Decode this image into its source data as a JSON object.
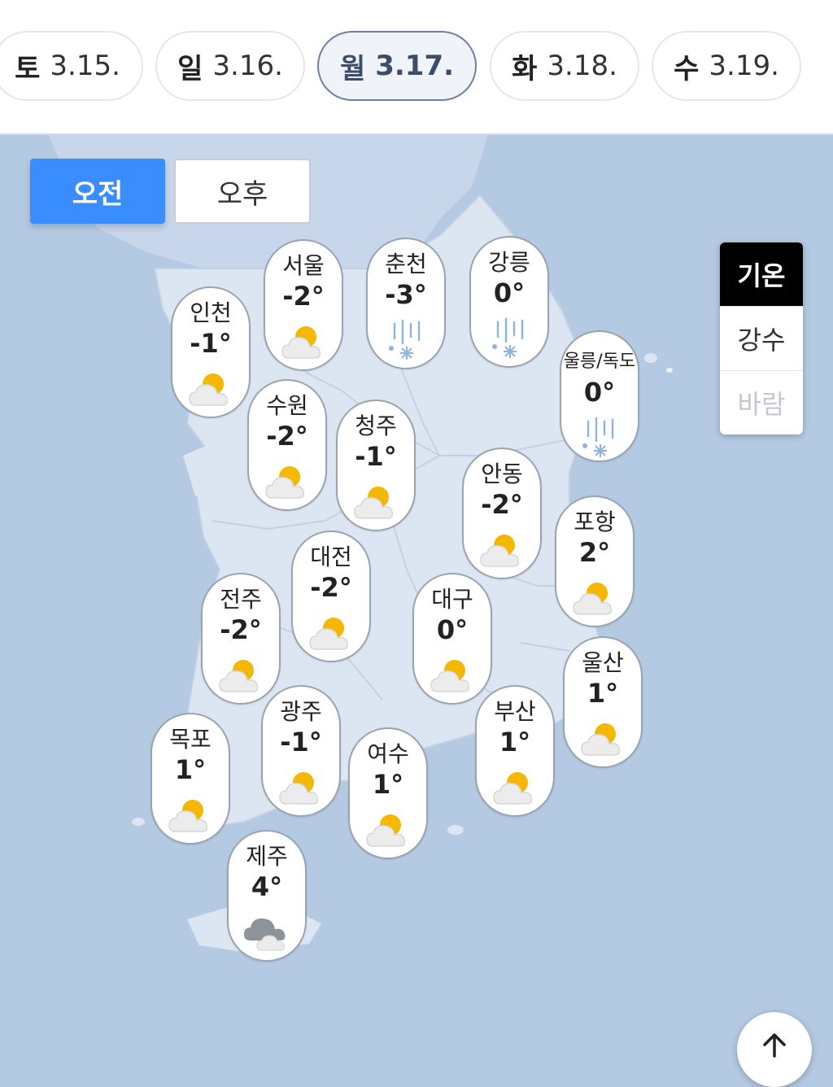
{
  "date_tabs": [
    {
      "dow": "토",
      "date": "3.15.",
      "selected": false
    },
    {
      "dow": "일",
      "date": "3.16.",
      "selected": false
    },
    {
      "dow": "월",
      "date": "3.17.",
      "selected": true
    },
    {
      "dow": "화",
      "date": "3.18.",
      "selected": false
    },
    {
      "dow": "수",
      "date": "3.19.",
      "selected": false
    }
  ],
  "period_toggle": {
    "am": "오전",
    "pm": "오후",
    "selected": "오전"
  },
  "layer_selector": {
    "temperature": "기온",
    "precipitation": "강수",
    "wind": "바람",
    "selected": "기온"
  },
  "cities": [
    {
      "name": "서울",
      "temp": "-2°",
      "icon": "partly-cloudy-icon"
    },
    {
      "name": "춘천",
      "temp": "-3°",
      "icon": "snow-icon"
    },
    {
      "name": "강릉",
      "temp": "0°",
      "icon": "snow-icon"
    },
    {
      "name": "인천",
      "temp": "-1°",
      "icon": "partly-cloudy-icon"
    },
    {
      "name": "울릉/독도",
      "temp": "0°",
      "icon": "snow-icon"
    },
    {
      "name": "수원",
      "temp": "-2°",
      "icon": "partly-cloudy-icon"
    },
    {
      "name": "청주",
      "temp": "-1°",
      "icon": "partly-cloudy-icon"
    },
    {
      "name": "안동",
      "temp": "-2°",
      "icon": "partly-cloudy-icon"
    },
    {
      "name": "포항",
      "temp": "2°",
      "icon": "partly-cloudy-icon"
    },
    {
      "name": "대전",
      "temp": "-2°",
      "icon": "partly-cloudy-icon"
    },
    {
      "name": "전주",
      "temp": "-2°",
      "icon": "partly-cloudy-icon"
    },
    {
      "name": "대구",
      "temp": "0°",
      "icon": "partly-cloudy-icon"
    },
    {
      "name": "울산",
      "temp": "1°",
      "icon": "partly-cloudy-icon"
    },
    {
      "name": "광주",
      "temp": "-1°",
      "icon": "partly-cloudy-icon"
    },
    {
      "name": "부산",
      "temp": "1°",
      "icon": "partly-cloudy-icon"
    },
    {
      "name": "목포",
      "temp": "1°",
      "icon": "partly-cloudy-icon"
    },
    {
      "name": "여수",
      "temp": "1°",
      "icon": "partly-cloudy-icon"
    },
    {
      "name": "제주",
      "temp": "4°",
      "icon": "cloudy-icon"
    }
  ],
  "colors": {
    "sea": "#b4c9e2",
    "land": "#dce6f3",
    "accent": "#3a8dff",
    "sun": "#f5b700",
    "snow": "#8fb3e0"
  },
  "scroll_top_icon": "arrow-up-icon"
}
